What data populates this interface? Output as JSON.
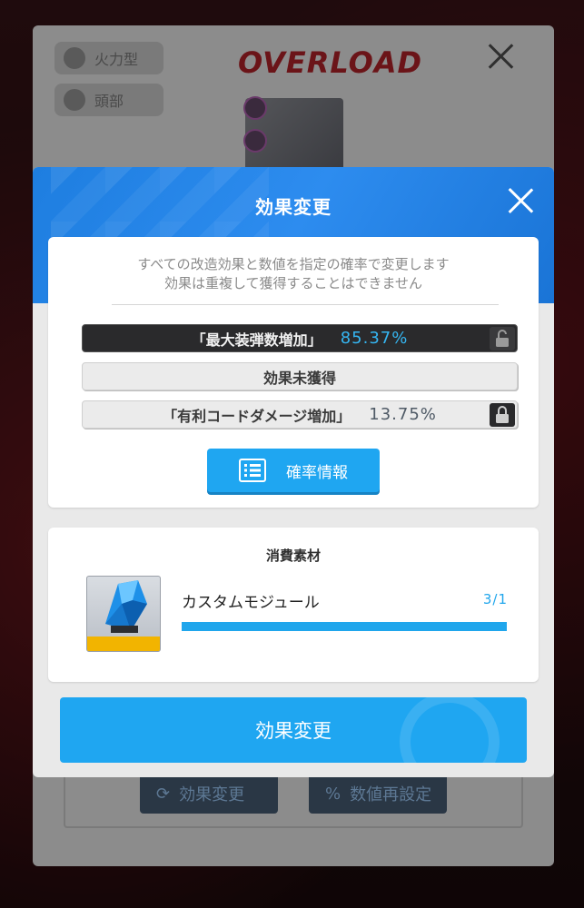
{
  "background": {
    "logo": "OVERLOAD",
    "chips": [
      {
        "label": "火力型",
        "icon": "firepower-type-icon"
      },
      {
        "label": "頭部",
        "icon": "head-part-icon"
      }
    ],
    "buttons": [
      {
        "label": "効果変更",
        "icon": "refresh-icon"
      },
      {
        "label": "数値再設定",
        "icon": "percent-icon"
      }
    ]
  },
  "dialog": {
    "title": "効果変更",
    "description_line1": "すべての改造効果と数値を指定の確率で変更します",
    "description_line2": "効果は重複して獲得することはできません",
    "effects": [
      {
        "name": "「最大装弾数増加」",
        "percent": "85.37%",
        "locked": true,
        "style": "dark"
      },
      {
        "name": "効果未獲得",
        "percent": "",
        "locked": false,
        "style": "light"
      },
      {
        "name": "「有利コードダメージ増加」",
        "percent": "13.75%",
        "locked": true,
        "style": "light"
      }
    ],
    "probability_button": "確率情報",
    "material": {
      "section_title": "消費素材",
      "name": "カスタムモジュール",
      "count": "3/1",
      "progress": 1.0
    },
    "confirm_button": "効果変更"
  },
  "colors": {
    "accent": "#1fa6f1",
    "header_blue": "#2d8cef",
    "percent_highlight": "#35b6f2"
  }
}
